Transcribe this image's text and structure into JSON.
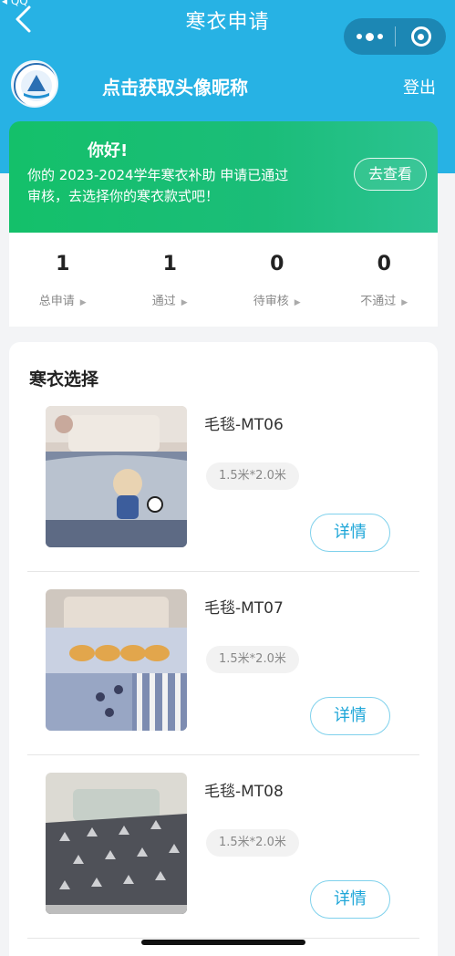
{
  "status": {
    "carrier": "QQ"
  },
  "header": {
    "title": "寒衣申请",
    "nickname_prompt": "点击获取头像昵称",
    "logout": "登出"
  },
  "greeting": {
    "title": "你好!",
    "message": "你的 2023-2024学年寒衣补助 申请已通过审核，去选择你的寒衣款式吧！",
    "button": "去查看"
  },
  "stats": [
    {
      "value": "1",
      "label": "总申请"
    },
    {
      "value": "1",
      "label": "通过"
    },
    {
      "value": "0",
      "label": "待审核"
    },
    {
      "value": "0",
      "label": "不通过"
    }
  ],
  "clothing": {
    "title": "寒衣选择",
    "items": [
      {
        "name": "毛毯-MT06",
        "spec": "1.5米*2.0米",
        "button": "详情"
      },
      {
        "name": "毛毯-MT07",
        "spec": "1.5米*2.0米",
        "button": "详情"
      },
      {
        "name": "毛毯-MT08",
        "spec": "1.5米*2.0米",
        "button": "详情"
      }
    ]
  },
  "colors": {
    "header": "#27b2e4",
    "greeting_card": "#14c06a",
    "accent": "#1ea6d8"
  },
  "icons": [
    "back-icon",
    "more-icon",
    "close-mini-program-icon",
    "chevron-right-icon"
  ]
}
